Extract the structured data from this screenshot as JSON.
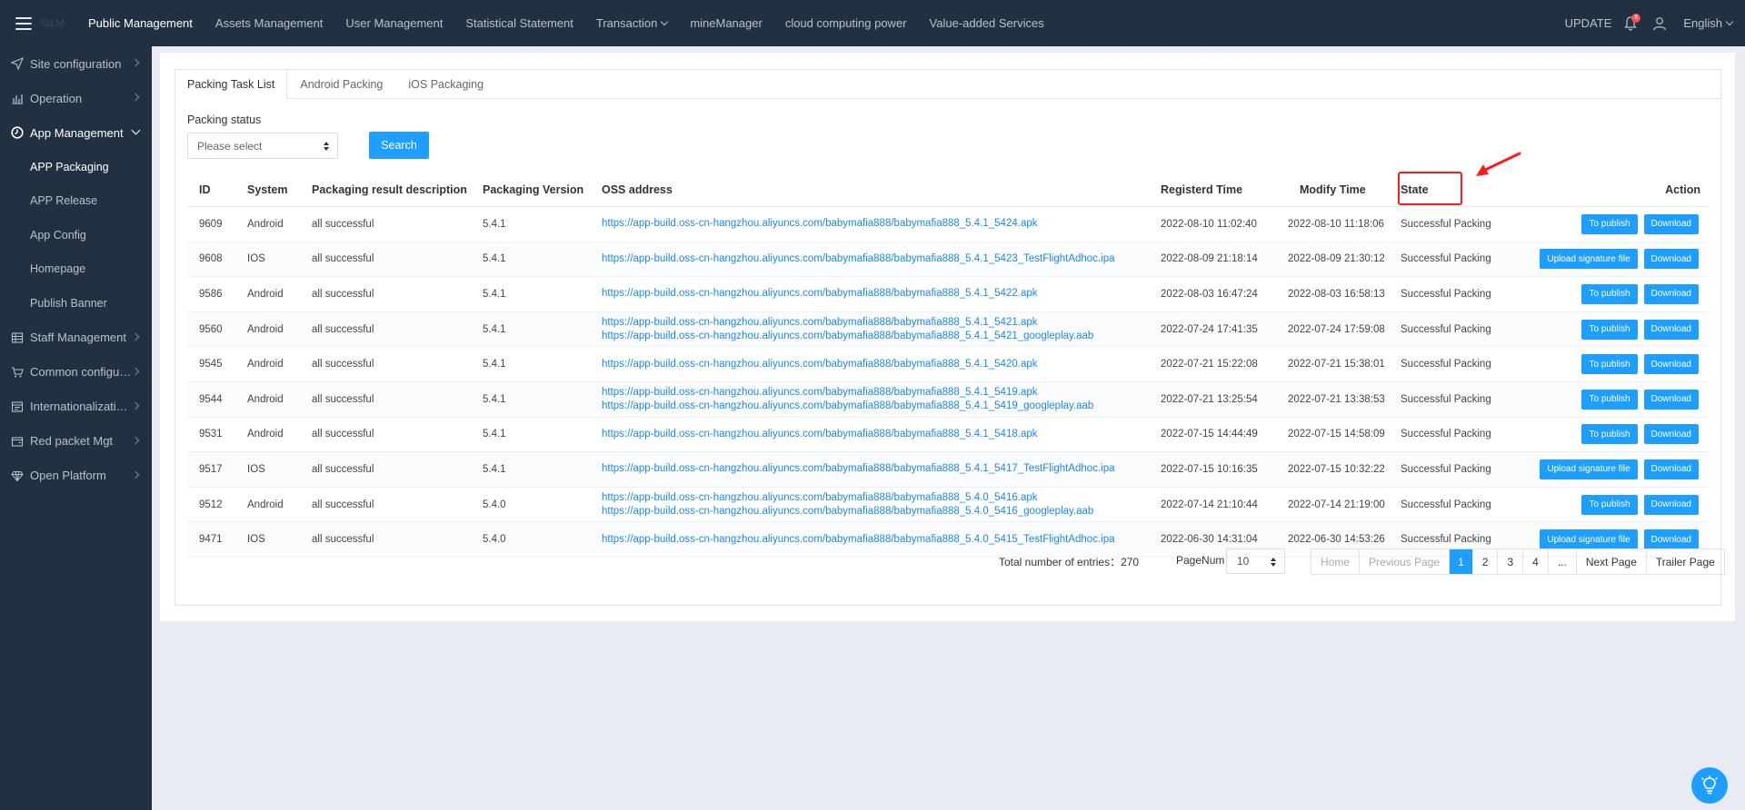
{
  "topbar": {
    "brand": "ISLM",
    "nav": [
      {
        "label": "Public Management",
        "active": true,
        "dropdown": false
      },
      {
        "label": "Assets Management",
        "active": false,
        "dropdown": false
      },
      {
        "label": "User Management",
        "active": false,
        "dropdown": false
      },
      {
        "label": "Statistical Statement",
        "active": false,
        "dropdown": false
      },
      {
        "label": "Transaction",
        "active": false,
        "dropdown": true
      },
      {
        "label": "mineManager",
        "active": false,
        "dropdown": false
      },
      {
        "label": "cloud computing power",
        "active": false,
        "dropdown": false
      },
      {
        "label": "Value-added Services",
        "active": false,
        "dropdown": false
      }
    ],
    "update_label": "UPDATE",
    "notification_count": "8",
    "language": "English"
  },
  "sidebar": {
    "items": [
      {
        "label": "Site configuration",
        "icon": "send-icon"
      },
      {
        "label": "Operation",
        "icon": "bar-chart-icon"
      },
      {
        "label": "App Management",
        "icon": "clock-icon",
        "open": true,
        "children": [
          {
            "label": "APP Packaging",
            "active": true
          },
          {
            "label": "APP Release"
          },
          {
            "label": "App Config"
          },
          {
            "label": "Homepage"
          },
          {
            "label": "Publish Banner"
          }
        ]
      },
      {
        "label": "Staff Management",
        "icon": "grid-icon"
      },
      {
        "label": "Common configura...",
        "icon": "cart-icon"
      },
      {
        "label": "Internationalization...",
        "icon": "window-icon"
      },
      {
        "label": "Red packet Mgt",
        "icon": "wallet-icon"
      },
      {
        "label": "Open Platform",
        "icon": "diamond-icon"
      }
    ]
  },
  "tabs": [
    "Packing Task List",
    "Android Packing",
    "iOS Packaging"
  ],
  "filter": {
    "label": "Packing status",
    "placeholder": "Please select",
    "search_label": "Search"
  },
  "table": {
    "headers": {
      "id": "ID",
      "system": "System",
      "desc": "Packaging result description",
      "version": "Packaging Version",
      "oss": "OSS address",
      "registered": "Registerd Time",
      "modified": "Modify Time",
      "state": "State",
      "action": "Action"
    },
    "rows": [
      {
        "id": "9609",
        "system": "Android",
        "desc": "all successful",
        "version": "5.4.1",
        "oss": [
          "https://app-build.oss-cn-hangzhou.aliyuncs.com/babymafia888/babymafia888_5.4.1_5424.apk"
        ],
        "registered": "2022-08-10 11:02:40",
        "modified": "2022-08-10 11:18:06",
        "state": "Successful Packing",
        "actions": [
          "To publish",
          "Download"
        ]
      },
      {
        "id": "9608",
        "system": "IOS",
        "desc": "all successful",
        "version": "5.4.1",
        "oss": [
          "https://app-build.oss-cn-hangzhou.aliyuncs.com/babymafia888/babymafia888_5.4.1_5423_TestFlightAdhoc.ipa"
        ],
        "registered": "2022-08-09 21:18:14",
        "modified": "2022-08-09 21:30:12",
        "state": "Successful Packing",
        "actions": [
          "Upload signature file",
          "Download"
        ]
      },
      {
        "id": "9586",
        "system": "Android",
        "desc": "all successful",
        "version": "5.4.1",
        "oss": [
          "https://app-build.oss-cn-hangzhou.aliyuncs.com/babymafia888/babymafia888_5.4.1_5422.apk"
        ],
        "registered": "2022-08-03 16:47:24",
        "modified": "2022-08-03 16:58:13",
        "state": "Successful Packing",
        "actions": [
          "To publish",
          "Download"
        ]
      },
      {
        "id": "9560",
        "system": "Android",
        "desc": "all successful",
        "version": "5.4.1",
        "oss": [
          "https://app-build.oss-cn-hangzhou.aliyuncs.com/babymafia888/babymafia888_5.4.1_5421.apk",
          "https://app-build.oss-cn-hangzhou.aliyuncs.com/babymafia888/babymafia888_5.4.1_5421_googleplay.aab"
        ],
        "registered": "2022-07-24 17:41:35",
        "modified": "2022-07-24 17:59:08",
        "state": "Successful Packing",
        "actions": [
          "To publish",
          "Download"
        ]
      },
      {
        "id": "9545",
        "system": "Android",
        "desc": "all successful",
        "version": "5.4.1",
        "oss": [
          "https://app-build.oss-cn-hangzhou.aliyuncs.com/babymafia888/babymafia888_5.4.1_5420.apk"
        ],
        "registered": "2022-07-21 15:22:08",
        "modified": "2022-07-21 15:38:01",
        "state": "Successful Packing",
        "actions": [
          "To publish",
          "Download"
        ]
      },
      {
        "id": "9544",
        "system": "Android",
        "desc": "all successful",
        "version": "5.4.1",
        "oss": [
          "https://app-build.oss-cn-hangzhou.aliyuncs.com/babymafia888/babymafia888_5.4.1_5419.apk",
          "https://app-build.oss-cn-hangzhou.aliyuncs.com/babymafia888/babymafia888_5.4.1_5419_googleplay.aab"
        ],
        "registered": "2022-07-21 13:25:54",
        "modified": "2022-07-21 13:38:53",
        "state": "Successful Packing",
        "actions": [
          "To publish",
          "Download"
        ]
      },
      {
        "id": "9531",
        "system": "Android",
        "desc": "all successful",
        "version": "5.4.1",
        "oss": [
          "https://app-build.oss-cn-hangzhou.aliyuncs.com/babymafia888/babymafia888_5.4.1_5418.apk"
        ],
        "registered": "2022-07-15 14:44:49",
        "modified": "2022-07-15 14:58:09",
        "state": "Successful Packing",
        "actions": [
          "To publish",
          "Download"
        ]
      },
      {
        "id": "9517",
        "system": "IOS",
        "desc": "all successful",
        "version": "5.4.1",
        "oss": [
          "https://app-build.oss-cn-hangzhou.aliyuncs.com/babymafia888/babymafia888_5.4.1_5417_TestFlightAdhoc.ipa"
        ],
        "registered": "2022-07-15 10:16:35",
        "modified": "2022-07-15 10:32:22",
        "state": "Successful Packing",
        "actions": [
          "Upload signature file",
          "Download"
        ]
      },
      {
        "id": "9512",
        "system": "Android",
        "desc": "all successful",
        "version": "5.4.0",
        "oss": [
          "https://app-build.oss-cn-hangzhou.aliyuncs.com/babymafia888/babymafia888_5.4.0_5416.apk",
          "https://app-build.oss-cn-hangzhou.aliyuncs.com/babymafia888/babymafia888_5.4.0_5416_googleplay.aab"
        ],
        "registered": "2022-07-14 21:10:44",
        "modified": "2022-07-14 21:19:00",
        "state": "Successful Packing",
        "actions": [
          "To publish",
          "Download"
        ]
      },
      {
        "id": "9471",
        "system": "IOS",
        "desc": "all successful",
        "version": "5.4.0",
        "oss": [
          "https://app-build.oss-cn-hangzhou.aliyuncs.com/babymafia888/babymafia888_5.4.0_5415_TestFlightAdhoc.ipa"
        ],
        "registered": "2022-06-30 14:31:04",
        "modified": "2022-06-30 14:53:26",
        "state": "Successful Packing",
        "actions": [
          "Upload signature file",
          "Download"
        ]
      }
    ]
  },
  "pagination": {
    "total_label": "Total number of entries：",
    "total": "270",
    "pagenum_label": "PageNum",
    "page_size": "10",
    "home": "Home",
    "prev": "Previous Page",
    "pages": [
      "1",
      "2",
      "3",
      "4"
    ],
    "ellipsis": "...",
    "next": "Next Page",
    "last": "Trailer Page",
    "current": "1"
  },
  "colors": {
    "nav_bg": "#223142",
    "accent": "#1e9fff",
    "link": "#1e88e5",
    "annotation": "#ff1a1a"
  }
}
